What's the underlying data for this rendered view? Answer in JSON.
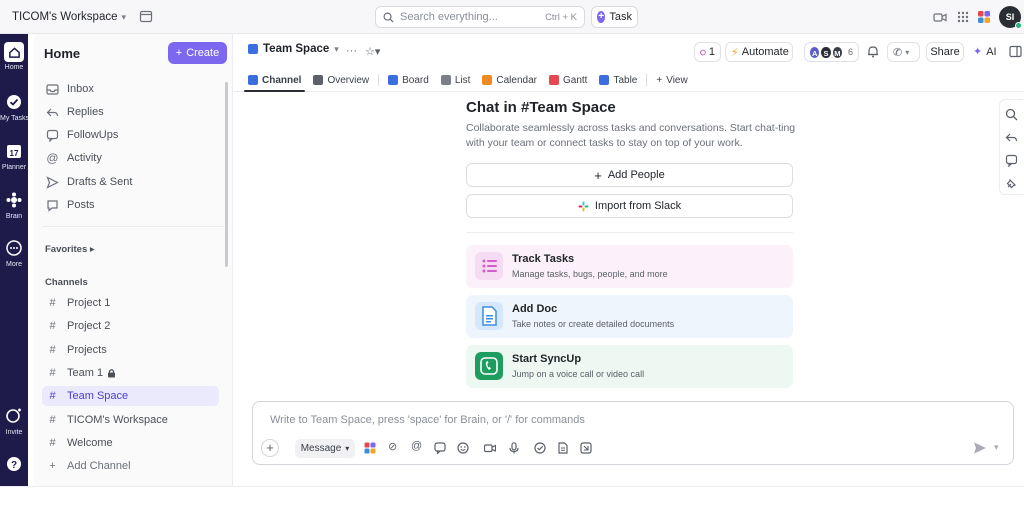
{
  "topbar": {
    "workspace_name": "TICOM's Workspace",
    "search_placeholder": "Search everything...",
    "search_shortcut": "Ctrl + K",
    "task_label": "Task",
    "avatar_initials": "SI"
  },
  "rail": {
    "items": [
      {
        "label": "Home",
        "icon": "home-icon"
      },
      {
        "label": "My Tasks",
        "icon": "check-circle-icon"
      },
      {
        "label": "Planner",
        "icon": "calendar-icon"
      },
      {
        "label": "Brain",
        "icon": "brain-icon"
      },
      {
        "label": "More",
        "icon": "more-icon"
      },
      {
        "label": "Invite",
        "icon": "invite-icon"
      },
      {
        "label": "",
        "icon": "help-icon"
      }
    ],
    "planner_day": "17"
  },
  "sidebar": {
    "title": "Home",
    "create_label": "Create",
    "nav": [
      {
        "label": "Inbox",
        "icon": "inbox-icon"
      },
      {
        "label": "Replies",
        "icon": "reply-icon"
      },
      {
        "label": "FollowUps",
        "icon": "followup-icon"
      },
      {
        "label": "Activity",
        "icon": "at-icon"
      },
      {
        "label": "Drafts & Sent",
        "icon": "send-icon"
      },
      {
        "label": "Posts",
        "icon": "posts-icon"
      }
    ],
    "favorites_label": "Favorites",
    "channels_label": "Channels",
    "channels": [
      {
        "label": "Project 1"
      },
      {
        "label": "Project 2"
      },
      {
        "label": "Projects"
      },
      {
        "label": "Team 1"
      },
      {
        "label": "Team Space"
      },
      {
        "label": "TICOM's Workspace"
      },
      {
        "label": "Welcome"
      },
      {
        "label": "Add Channel"
      }
    ]
  },
  "header": {
    "space_name": "Team Space",
    "notif_count": "1",
    "automate_label": "Automate",
    "members": [
      "A",
      "S",
      "M"
    ],
    "member_count": "6",
    "share_label": "Share",
    "ai_label": "AI",
    "tabs": [
      {
        "label": "Channel",
        "color": "#3b6fe0"
      },
      {
        "label": "Overview",
        "color": "#5b6069"
      },
      {
        "label": "Board",
        "color": "#3b6fe0"
      },
      {
        "label": "List",
        "color": "#7a7f88"
      },
      {
        "label": "Calendar",
        "color": "#f08a24"
      },
      {
        "label": "Gantt",
        "color": "#e5484d"
      },
      {
        "label": "Table",
        "color": "#3b6fe0"
      },
      {
        "label": "View",
        "color": "#5b6069"
      }
    ]
  },
  "main": {
    "title": "Chat in #Team Space",
    "description": "Collaborate seamlessly across tasks and conversations. Start chat-ting with your team or connect tasks to stay on top of your work.",
    "add_people_label": "Add People",
    "import_slack_label": "Import from Slack",
    "cards": [
      {
        "title": "Track Tasks",
        "desc": "Manage tasks, bugs, people, and more",
        "bg": "#fcf1fb",
        "icon_bg": "#f6dcf3",
        "accent": "#d65ccc"
      },
      {
        "title": "Add Doc",
        "desc": "Take notes or create detailed documents",
        "bg": "#eef5fd",
        "icon_bg": "#d6e7fb",
        "accent": "#3b8ee0"
      },
      {
        "title": "Start SyncUp",
        "desc": "Jump on a voice call or video call",
        "bg": "#ecf8f1",
        "icon_bg": "#1f9d61",
        "accent": "#ffffff"
      }
    ]
  },
  "composer": {
    "placeholder": "Write to Team Space, press 'space' for Brain, or '/' for commands",
    "message_type": "Message"
  }
}
